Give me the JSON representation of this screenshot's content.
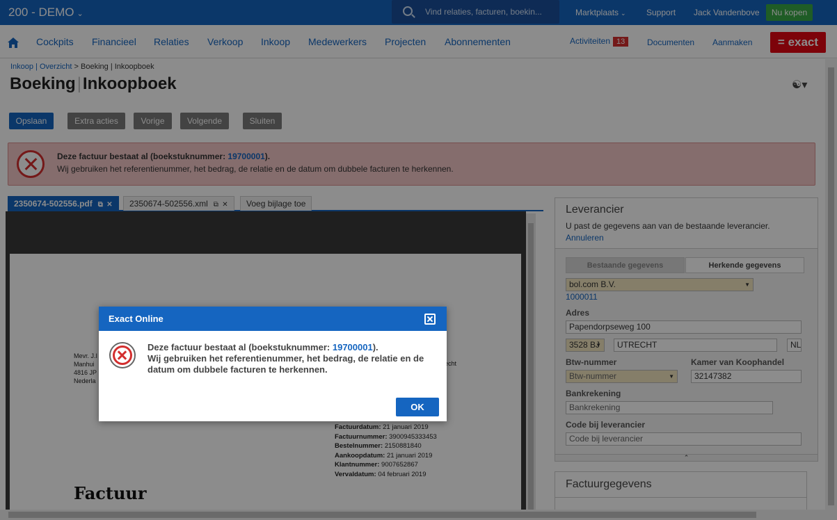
{
  "topbar": {
    "company": "200 - DEMO",
    "search_placeholder": "Vind relaties, facturen, boekin...",
    "marketplace": "Marktplaats",
    "support": "Support",
    "user": "Jack Vandenbove",
    "buy": "Nu kopen"
  },
  "nav": {
    "items": [
      "Cockpits",
      "Financieel",
      "Relaties",
      "Verkoop",
      "Inkoop",
      "Medewerkers",
      "Projecten",
      "Abonnementen"
    ],
    "activities": "Activiteiten",
    "activities_count": "13",
    "documents": "Documenten",
    "create": "Aanmaken",
    "logo": "= exact"
  },
  "breadcrumb": {
    "link": "Inkoop | Overzicht",
    "sep": ">",
    "current": "Boeking | Inkoopboek"
  },
  "page": {
    "title_main": "Boeking",
    "title_sep": "|",
    "title_sub": "Inkoopboek"
  },
  "buttons": {
    "save": "Opslaan",
    "extra": "Extra acties",
    "prev": "Vorige",
    "next": "Volgende",
    "close": "Sluiten"
  },
  "alert": {
    "prefix": "Deze factuur bestaat al (boekstuknummer: ",
    "number": "19700001",
    "suffix": ").",
    "detail": "Wij gebruiken het referentienummer, het bedrag, de relatie en de datum om dubbele facturen te herkennen."
  },
  "tabs": [
    {
      "label": "2350674-502556.pdf"
    },
    {
      "label": "2350674-502556.xml"
    },
    {
      "label": "Voeg bijlage toe"
    }
  ],
  "document": {
    "address_lines": [
      "Mevr. J.I",
      "Manhui",
      "4816 JP",
      "Nederla"
    ],
    "address_right": "echt",
    "meta": [
      {
        "label": "Factuurdatum:",
        "value": "21 januari 2019"
      },
      {
        "label": "Factuurnummer:",
        "value": "3900945333453"
      },
      {
        "label": "Bestelnummer:",
        "value": "2150881840"
      },
      {
        "label": "Aankoopdatum:",
        "value": "21 januari 2019"
      },
      {
        "label": "Klantnummer:",
        "value": "9007652867"
      },
      {
        "label": "Vervaldatum:",
        "value": "04 februari 2019"
      }
    ],
    "heading": "Factuur"
  },
  "supplier_panel": {
    "title": "Leverancier",
    "description": "U past de gegevens aan van de bestaande leverancier.",
    "cancel": "Annuleren",
    "tab_existing": "Bestaande gegevens",
    "tab_recognized": "Herkende gegevens",
    "supplier_name": "bol.com B.V.",
    "supplier_code": "1000011",
    "address_label": "Adres",
    "street": "Papendorpseweg 100",
    "postcode": "3528 BJ",
    "city": "UTRECHT",
    "country": "NL",
    "vat_label": "Btw-nummer",
    "vat_placeholder": "Btw-nummer",
    "kvk_label": "Kamer van Koophandel",
    "kvk_value": "32147382",
    "bank_label": "Bankrekening",
    "bank_placeholder": "Bankrekening",
    "code_label": "Code bij leverancier",
    "code_placeholder": "Code bij leverancier"
  },
  "invoice_panel": {
    "title": "Factuurgegevens"
  },
  "modal": {
    "title": "Exact Online",
    "line1_prefix": "Deze factuur bestaat al (boekstuknummer: ",
    "number": "19700001",
    "line1_suffix": ").",
    "line2": "Wij gebruiken het referentienummer, het bedrag, de relatie en de datum om dubbele facturen te herkennen.",
    "ok": "OK"
  },
  "colors": {
    "brand_blue": "#1565c0",
    "exact_red": "#e30613",
    "buy_green": "#39a845",
    "error_red": "#d32f2f"
  }
}
